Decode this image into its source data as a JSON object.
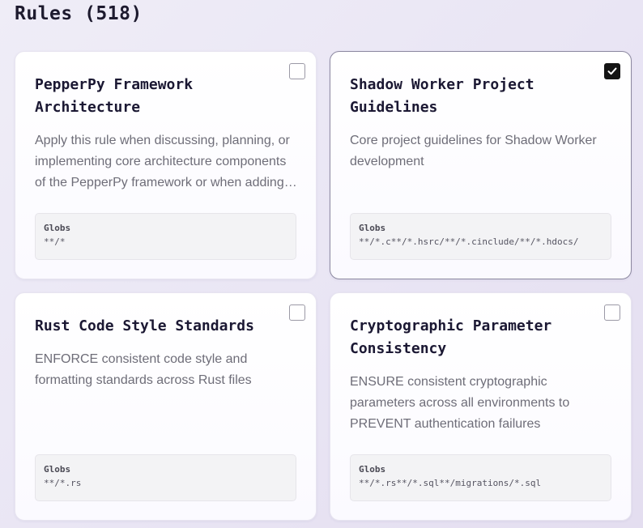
{
  "page": {
    "title": "Rules (518)"
  },
  "globs_label": "Globs",
  "cards": [
    {
      "title": "PepperPy Framework Architecture",
      "description": "Apply this rule when discussing, planning, or implementing core architecture components of the PepperPy framework or when adding new modules",
      "globs": "**/*",
      "checked": false
    },
    {
      "title": "Shadow Worker Project Guidelines",
      "description": "Core project guidelines for Shadow Worker development",
      "globs": "**/*.c**/*.hsrc/**/*.cinclude/**/*.hdocs/",
      "checked": true
    },
    {
      "title": "Rust Code Style Standards",
      "description": "ENFORCE consistent code style and formatting standards across Rust files",
      "globs": "**/*.rs",
      "checked": false
    },
    {
      "title": "Cryptographic Parameter Consistency",
      "description": "ENSURE consistent cryptographic parameters across all environments to PREVENT authentication failures",
      "globs": "**/*.rs**/*.sql**/migrations/*.sql",
      "checked": false
    }
  ]
}
